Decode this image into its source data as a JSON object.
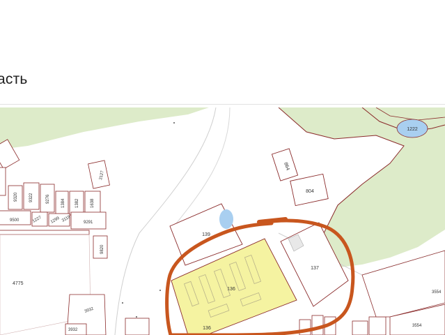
{
  "page": {
    "title": "асть"
  },
  "map": {
    "colors": {
      "forest": "#ddebc9",
      "field": "#ffffff",
      "highlight_parcel": "#f5f3a1",
      "water": "#a9cff0",
      "parcel_stroke": "#8a2a2a",
      "annotation": "#c8561e"
    },
    "labels": {
      "p1222": "1222",
      "p864": "864",
      "p804": "804",
      "p139": "139",
      "p137": "137",
      "p136": "136",
      "p136b": "136",
      "p4775": "4775",
      "p3554a": "3554",
      "p3554b": "3554",
      "p3932a": "3932",
      "p3932b": "3932",
      "p9820": "9820",
      "p9291": "9291",
      "p3127": "3127",
      "p9320": "9320",
      "p9322": "9322",
      "p9276": "9276",
      "p1384": "1384",
      "p1382": "1382",
      "p1384b": "1384",
      "p1638": "1638",
      "p9500": "9500",
      "p1227": "1227",
      "p1299": "1299",
      "p3119": "3119"
    }
  }
}
